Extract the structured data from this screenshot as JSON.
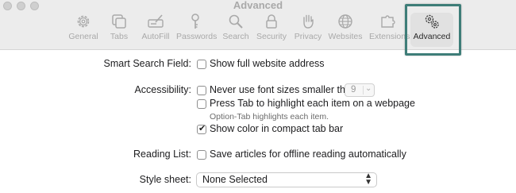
{
  "window": {
    "title": "Advanced"
  },
  "tabs": [
    {
      "label": "General",
      "icon": "gear-icon"
    },
    {
      "label": "Tabs",
      "icon": "tabs-icon"
    },
    {
      "label": "AutoFill",
      "icon": "autofill-icon"
    },
    {
      "label": "Passwords",
      "icon": "key-icon"
    },
    {
      "label": "Search",
      "icon": "magnifier-icon"
    },
    {
      "label": "Security",
      "icon": "lock-icon"
    },
    {
      "label": "Privacy",
      "icon": "hand-icon"
    },
    {
      "label": "Websites",
      "icon": "globe-icon"
    },
    {
      "label": "Extensions",
      "icon": "puzzle-icon"
    },
    {
      "label": "Advanced",
      "icon": "gears-icon",
      "selected": true
    }
  ],
  "settings": {
    "smart_search": {
      "label": "Smart Search Field:",
      "option": "Show full website address",
      "checked": false
    },
    "accessibility": {
      "label": "Accessibility:",
      "font_option": "Never use font sizes smaller than",
      "font_size": "9",
      "tab_option": "Press Tab to highlight each item on a webpage",
      "tab_hint": "Option-Tab highlights each item.",
      "color_option": "Show color in compact tab bar",
      "color_checked": true
    },
    "reading_list": {
      "label": "Reading List:",
      "option": "Save articles for offline reading automatically",
      "checked": false
    },
    "style_sheet": {
      "label": "Style sheet:",
      "value": "None Selected"
    }
  },
  "colors": {
    "highlight_border": "#3e7d78",
    "toolbar_bg": "#ececec"
  }
}
